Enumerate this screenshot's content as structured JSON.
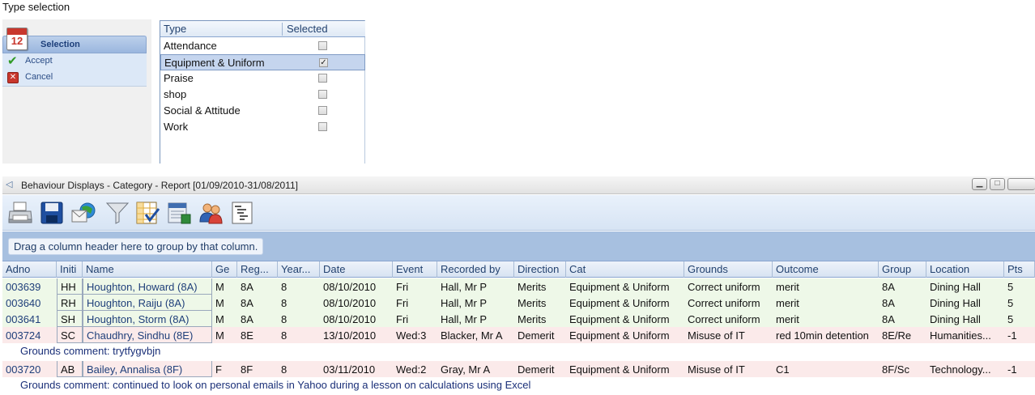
{
  "dialog": {
    "title": "Type selection",
    "calendar_number": "12",
    "selection_panel": {
      "header": "Selection",
      "accept_label": "Accept",
      "cancel_label": "Cancel"
    },
    "type_grid": {
      "columns": [
        "Type",
        "Selected"
      ],
      "rows": [
        {
          "name": "Attendance",
          "selected": false
        },
        {
          "name": "Equipment & Uniform",
          "selected": true
        },
        {
          "name": "Praise",
          "selected": false
        },
        {
          "name": "shop",
          "selected": false
        },
        {
          "name": "Social & Attitude",
          "selected": false
        },
        {
          "name": "Work",
          "selected": false
        }
      ]
    }
  },
  "window": {
    "title": "Behaviour Displays - Category - Report [01/09/2010-31/08/2011]",
    "toolbar": [
      "print-icon",
      "save-icon",
      "email-icon",
      "filter-icon",
      "grid-check-icon",
      "database-icon",
      "users-icon",
      "tree-list-icon"
    ],
    "group_hint": "Drag a column header here to group by that column.",
    "columns": [
      "Adno",
      "Initi",
      "Name",
      "Ge",
      "Reg...",
      "Year...",
      "Date",
      "Event",
      "Recorded by",
      "Direction",
      "Cat",
      "Grounds",
      "Outcome",
      "Group",
      "Location",
      "Pts"
    ],
    "rows": [
      {
        "adno": "003639",
        "initials": "HH",
        "name": "Houghton, Howard (8A)",
        "gender": "M",
        "reg": "8A",
        "year": "8",
        "date": "08/10/2010",
        "event": "Fri",
        "recorded_by": "Hall, Mr P",
        "direction": "Merits",
        "cat": "Equipment & Uniform",
        "grounds": "Correct uniform",
        "outcome": "merit",
        "group": "8A",
        "location": "Dining Hall",
        "pts": "5",
        "comment": ""
      },
      {
        "adno": "003640",
        "initials": "RH",
        "name": "Houghton, Raiju (8A)",
        "gender": "M",
        "reg": "8A",
        "year": "8",
        "date": "08/10/2010",
        "event": "Fri",
        "recorded_by": "Hall, Mr P",
        "direction": "Merits",
        "cat": "Equipment & Uniform",
        "grounds": "Correct uniform",
        "outcome": "merit",
        "group": "8A",
        "location": "Dining Hall",
        "pts": "5",
        "comment": ""
      },
      {
        "adno": "003641",
        "initials": "SH",
        "name": "Houghton, Storm (8A)",
        "gender": "M",
        "reg": "8A",
        "year": "8",
        "date": "08/10/2010",
        "event": "Fri",
        "recorded_by": "Hall, Mr P",
        "direction": "Merits",
        "cat": "Equipment & Uniform",
        "grounds": "Correct uniform",
        "outcome": "merit",
        "group": "8A",
        "location": "Dining Hall",
        "pts": "5",
        "comment": ""
      },
      {
        "adno": "003724",
        "initials": "SC",
        "name": "Chaudhry, Sindhu (8E)",
        "gender": "M",
        "reg": "8E",
        "year": "8",
        "date": "13/10/2010",
        "event": "Wed:3",
        "recorded_by": "Blacker, Mr A",
        "direction": "Demerit",
        "cat": "Equipment & Uniform",
        "grounds": "Misuse of IT",
        "outcome": "red 10min detention",
        "group": "8E/Re",
        "location": "Humanities...",
        "pts": "-1",
        "comment": "Grounds comment: trytfygvbjn"
      },
      {
        "adno": "003720",
        "initials": "AB",
        "name": "Bailey, Annalisa (8F)",
        "gender": "F",
        "reg": "8F",
        "year": "8",
        "date": "03/11/2010",
        "event": "Wed:2",
        "recorded_by": "Gray, Mr A",
        "direction": "Demerit",
        "cat": "Equipment & Uniform",
        "grounds": "Misuse of IT",
        "outcome": "C1",
        "group": "8F/Sc",
        "location": "Technology...",
        "pts": "-1",
        "comment": "Grounds comment: continued to look on personal emails in Yahoo during a lesson on calculations using Excel"
      }
    ]
  }
}
